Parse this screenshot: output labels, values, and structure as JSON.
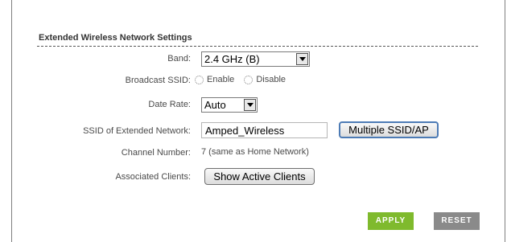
{
  "section": {
    "title": "Extended Wireless Network Settings"
  },
  "band": {
    "label": "Band:",
    "value": "2.4 GHz (B)"
  },
  "broadcast_ssid": {
    "label": "Broadcast SSID:",
    "option_enable": "Enable",
    "option_disable": "Disable"
  },
  "date_rate": {
    "label": "Date Rate:",
    "value": "Auto"
  },
  "ssid": {
    "label": "SSID of Extended Network:",
    "value": "Amped_Wireless",
    "button": "Multiple SSID/AP"
  },
  "channel": {
    "label": "Channel Number:",
    "value": "7 (same as Home Network)"
  },
  "clients": {
    "label": "Associated Clients:",
    "button": "Show Active Clients"
  },
  "actions": {
    "apply": "APPLY",
    "reset": "RESET"
  },
  "colors": {
    "apply": "#7fba2d",
    "reset": "#8a8a8a",
    "focus_border": "#4d7bb5"
  }
}
